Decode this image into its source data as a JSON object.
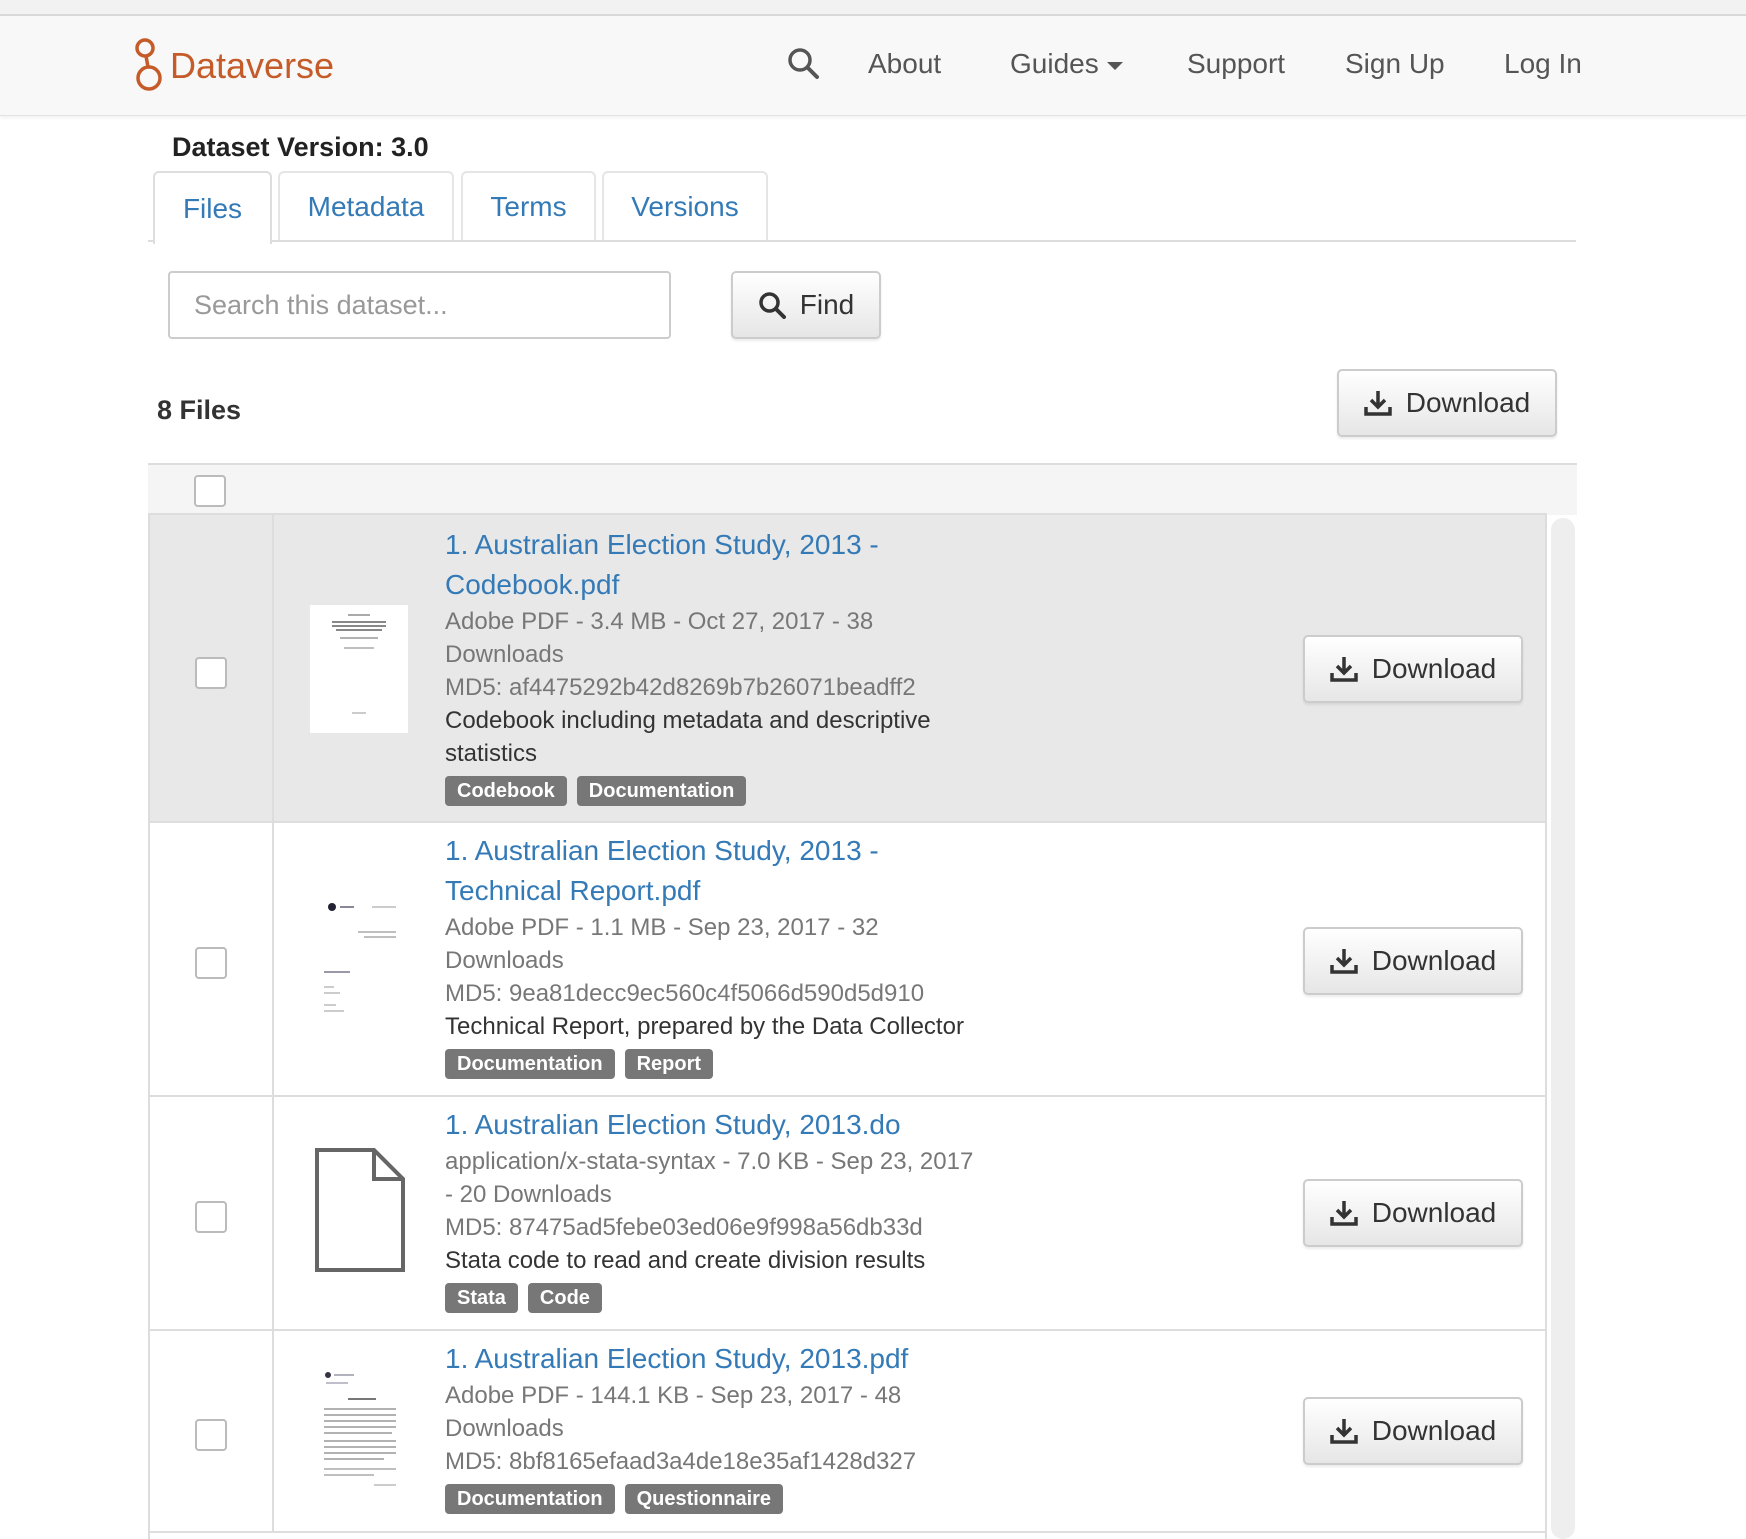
{
  "navbar": {
    "brand": "Dataverse",
    "items": [
      {
        "label": "About"
      },
      {
        "label": "Guides"
      },
      {
        "label": "Support"
      },
      {
        "label": "Sign Up"
      },
      {
        "label": "Log In"
      }
    ]
  },
  "dataset": {
    "version_label": "Dataset Version: 3.0"
  },
  "tabs": [
    {
      "label": "Files",
      "active": true
    },
    {
      "label": "Metadata"
    },
    {
      "label": "Terms"
    },
    {
      "label": "Versions"
    }
  ],
  "search": {
    "placeholder": "Search this dataset...",
    "find_label": "Find"
  },
  "files_header": {
    "count_label": "8 Files",
    "download_all_label": "Download"
  },
  "files": [
    {
      "name_line1": "1. Australian Election Study, 2013 -",
      "name_line2": "Codebook.pdf",
      "meta_line1": "Adobe PDF - 3.4 MB - Oct 27, 2017 - 38",
      "meta_line2": "Downloads",
      "md5": "MD5: af4475292b42d8269b7b26071beadff2",
      "desc_line1": "Codebook including metadata and descriptive",
      "desc_line2": "statistics",
      "tags": [
        "Codebook",
        "Documentation"
      ],
      "download_label": "Download",
      "thumbnail": "pdf-thumbnail-icon"
    },
    {
      "name_line1": "1. Australian Election Study, 2013 -",
      "name_line2": "Technical Report.pdf",
      "meta_line1": "Adobe PDF - 1.1 MB - Sep 23, 2017 - 32",
      "meta_line2": "Downloads",
      "md5": "MD5: 9ea81decc9ec560c4f5066d590d5d910",
      "desc_line1": "Technical Report, prepared by the Data Collector",
      "tags": [
        "Documentation",
        "Report"
      ],
      "download_label": "Download",
      "thumbnail": "pdf-thumbnail-icon"
    },
    {
      "name_line1": "1. Australian Election Study, 2013.do",
      "meta_line1": "application/x-stata-syntax - 7.0 KB - Sep 23, 2017",
      "meta_line2": "- 20 Downloads",
      "md5": "MD5: 87475ad5febe03ed06e9f998a56db33d",
      "desc_line1": "Stata code to read and create division results",
      "tags": [
        "Stata",
        "Code"
      ],
      "download_label": "Download",
      "thumbnail": "generic-file-icon"
    },
    {
      "name_line1": "1. Australian Election Study, 2013.pdf",
      "meta_line1": "Adobe PDF - 144.1 KB - Sep 23, 2017 - 48",
      "meta_line2": "Downloads",
      "md5": "MD5: 8bf8165efaad3a4de18e35af1428d327",
      "tags": [
        "Documentation",
        "Questionnaire"
      ],
      "download_label": "Download",
      "thumbnail": "pdf-thumbnail-icon"
    }
  ],
  "colors": {
    "brand": "#c55b28",
    "link": "#337ab7",
    "tag_bg": "#777777",
    "row_highlight": "#e8e8e8"
  }
}
